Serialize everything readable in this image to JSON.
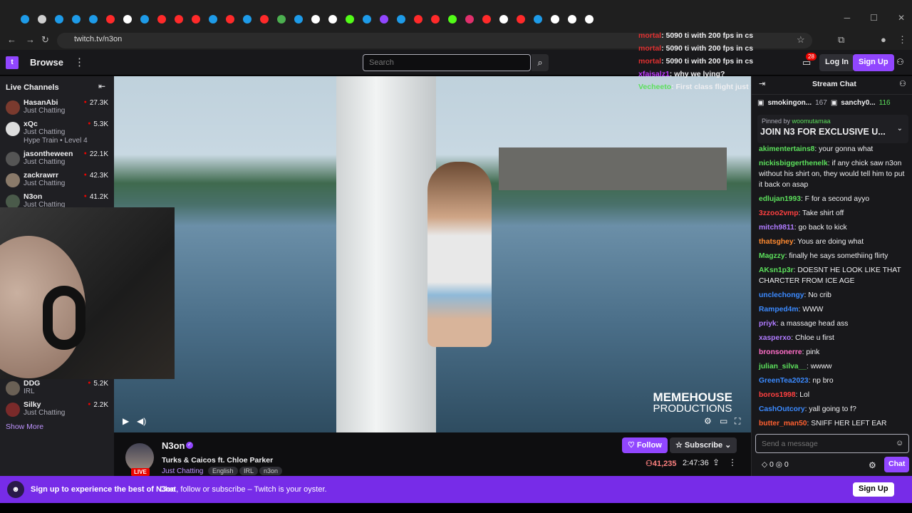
{
  "browser": {
    "url": "twitch.tv/n3on",
    "tab_icons": [
      {
        "name": "edge-icon",
        "color": "#1e9be8"
      },
      {
        "name": "chrome-icon",
        "color": "#cfcfcf"
      },
      {
        "name": "edge-icon",
        "color": "#1e9be8"
      },
      {
        "name": "edge-icon",
        "color": "#1e9be8"
      },
      {
        "name": "edge-icon",
        "color": "#1e9be8"
      },
      {
        "name": "youtube-icon",
        "color": "#ff2a2a"
      },
      {
        "name": "tiktok-icon",
        "color": "#ffffff"
      },
      {
        "name": "edge-icon",
        "color": "#1e9be8"
      },
      {
        "name": "youtube-icon",
        "color": "#ff2a2a"
      },
      {
        "name": "youtube-icon",
        "color": "#ff2a2a"
      },
      {
        "name": "youtube-icon",
        "color": "#ff2a2a"
      },
      {
        "name": "edge-icon",
        "color": "#1e9be8"
      },
      {
        "name": "youtube-icon",
        "color": "#ff2a2a"
      },
      {
        "name": "edge-icon",
        "color": "#1e9be8"
      },
      {
        "name": "youtube-icon",
        "color": "#ff2a2a"
      },
      {
        "name": "google-icon",
        "color": "#4cb050"
      },
      {
        "name": "edge-icon",
        "color": "#1e9be8"
      },
      {
        "name": "x-icon",
        "color": "#ffffff"
      },
      {
        "name": "x-icon",
        "color": "#ffffff"
      },
      {
        "name": "kick-icon",
        "color": "#53fc18"
      },
      {
        "name": "edge-icon",
        "color": "#1e9be8"
      },
      {
        "name": "twitch-icon",
        "color": "#9146ff"
      },
      {
        "name": "edge-icon",
        "color": "#1e9be8"
      },
      {
        "name": "youtube-icon",
        "color": "#ff2a2a"
      },
      {
        "name": "youtube-icon",
        "color": "#ff2a2a"
      },
      {
        "name": "kick-icon",
        "color": "#53fc18"
      },
      {
        "name": "instagram-icon",
        "color": "#e1306c"
      },
      {
        "name": "youtube-icon",
        "color": "#ff2a2a"
      },
      {
        "name": "x-icon",
        "color": "#ffffff"
      },
      {
        "name": "youtube-icon",
        "color": "#ff2a2a"
      },
      {
        "name": "edge-icon",
        "color": "#1e9be8"
      },
      {
        "name": "x-icon",
        "color": "#ffffff"
      },
      {
        "name": "x-icon",
        "color": "#ffffff"
      },
      {
        "name": "x-icon",
        "color": "#ffffff"
      }
    ]
  },
  "nav": {
    "browse": "Browse",
    "search_placeholder": "Search",
    "notif_count": "28",
    "login": "Log In",
    "signup": "Sign Up"
  },
  "sidebar": {
    "title": "Live Channels",
    "channels": [
      {
        "name": "HasanAbi",
        "category": "Just Chatting",
        "viewers": "27.3K"
      },
      {
        "name": "xQc",
        "category": "Just Chatting",
        "viewers": "5.3K",
        "extra": "Hype Train • Level 4"
      },
      {
        "name": "jasontheween",
        "category": "Just Chatting",
        "viewers": "22.1K"
      },
      {
        "name": "zackrawrr",
        "category": "Just Chatting",
        "viewers": "42.3K"
      },
      {
        "name": "N3on",
        "category": "Just Chatting",
        "viewers": "41.2K"
      },
      {
        "name": "DDG",
        "category": "IRL",
        "viewers": "5.2K"
      },
      {
        "name": "Silky",
        "category": "Just Chatting",
        "viewers": "2.2K"
      }
    ],
    "show_more": "Show More"
  },
  "overlay_chat": [
    {
      "user": "mortal",
      "text": ": 5090 ti with 200 fps in cs"
    },
    {
      "user": "mortal",
      "text": ": 5090 ti with 200 fps in cs"
    },
    {
      "user": "mortal",
      "text": ": 5090 ti with 200 fps in cs"
    },
    {
      "user": "xfaisalz1",
      "text": ": why we lying?"
    },
    {
      "user": "Vecheeto",
      "text": ": First class flight just to not stream the entire trip W"
    }
  ],
  "video": {
    "watermark_line1": "MEMEHOUSE",
    "watermark_line2": "PRODUCTIONS"
  },
  "stream": {
    "name": "N3on",
    "title": "Turks & Caicos ft. Chloe Parker",
    "category": "Just Chatting",
    "tags": [
      "English",
      "IRL",
      "n3on"
    ],
    "live": "LIVE",
    "follow": "Follow",
    "subscribe": "Subscribe",
    "viewers": "41,235",
    "uptime": "2:47:36"
  },
  "chat": {
    "header": "Stream Chat",
    "gifters": [
      {
        "name": "smokingon...",
        "count": "167"
      },
      {
        "name": "sanchy0...",
        "count": "116"
      }
    ],
    "pinned_by": "Pinned by",
    "pinned_user": "woomutamaa",
    "pinned_msg": "JOIN N3 FOR EXCLUSIVE U...",
    "messages": [
      {
        "user": "akimentertains8",
        "color": "#5ce05c",
        "text": ": your gonna what"
      },
      {
        "user": "nickisbiggerthenelk",
        "color": "#5ce05c",
        "text": ": if any chick saw n3on without his shirt on, they would tell him to put it back on asap"
      },
      {
        "user": "edlujan1993",
        "color": "#5ce05c",
        "text": ": F for a second ayyo"
      },
      {
        "user": "3zzoo2vmp",
        "color": "#ff4040",
        "text": ": Take shirt off"
      },
      {
        "user": "mitch9811",
        "color": "#b07bff",
        "text": ": go back to kick"
      },
      {
        "user": "thatsghey",
        "color": "#ff8a30",
        "text": ": Yous are doing what"
      },
      {
        "user": "Magzzy",
        "color": "#5ce05c",
        "text": ": finally he says somethiing flirty"
      },
      {
        "user": "AKsn1p3r",
        "color": "#5ce05c",
        "text": ": DOESNT HE LOOK LIKE THAT CHARCTER FROM ICE AGE"
      },
      {
        "user": "unclechongy",
        "color": "#3b8aff",
        "text": ": No crib"
      },
      {
        "user": "Ramped4m",
        "color": "#3b8aff",
        "text": ": WWW"
      },
      {
        "user": "priyk",
        "color": "#b07bff",
        "text": ": a massage head ass"
      },
      {
        "user": "xasperxo",
        "color": "#b07bff",
        "text": ": Chloe u first"
      },
      {
        "user": "bronsonerre",
        "color": "#ff6ec7",
        "text": ": pink"
      },
      {
        "user": "julian_silva__",
        "color": "#5ce05c",
        "text": ": wwww"
      },
      {
        "user": "GreenTea2023",
        "color": "#3b8aff",
        "text": ": np bro"
      },
      {
        "user": "boros1998",
        "color": "#ff4040",
        "text": ": Lol"
      },
      {
        "user": "CashOutcory",
        "color": "#3b8aff",
        "text": ": yall going to f?"
      },
      {
        "user": "butter_man50",
        "color": "#ff6030",
        "text": ": SNIFF HER LEFT EAR"
      }
    ],
    "input_placeholder": "Send a message",
    "points_a": "0",
    "points_b": "0",
    "chat_button": "Chat"
  },
  "banner": {
    "bold": "Sign up to experience the best of N3on",
    "text": "Chat, follow or subscribe – Twitch is your oyster.",
    "button": "Sign Up"
  }
}
